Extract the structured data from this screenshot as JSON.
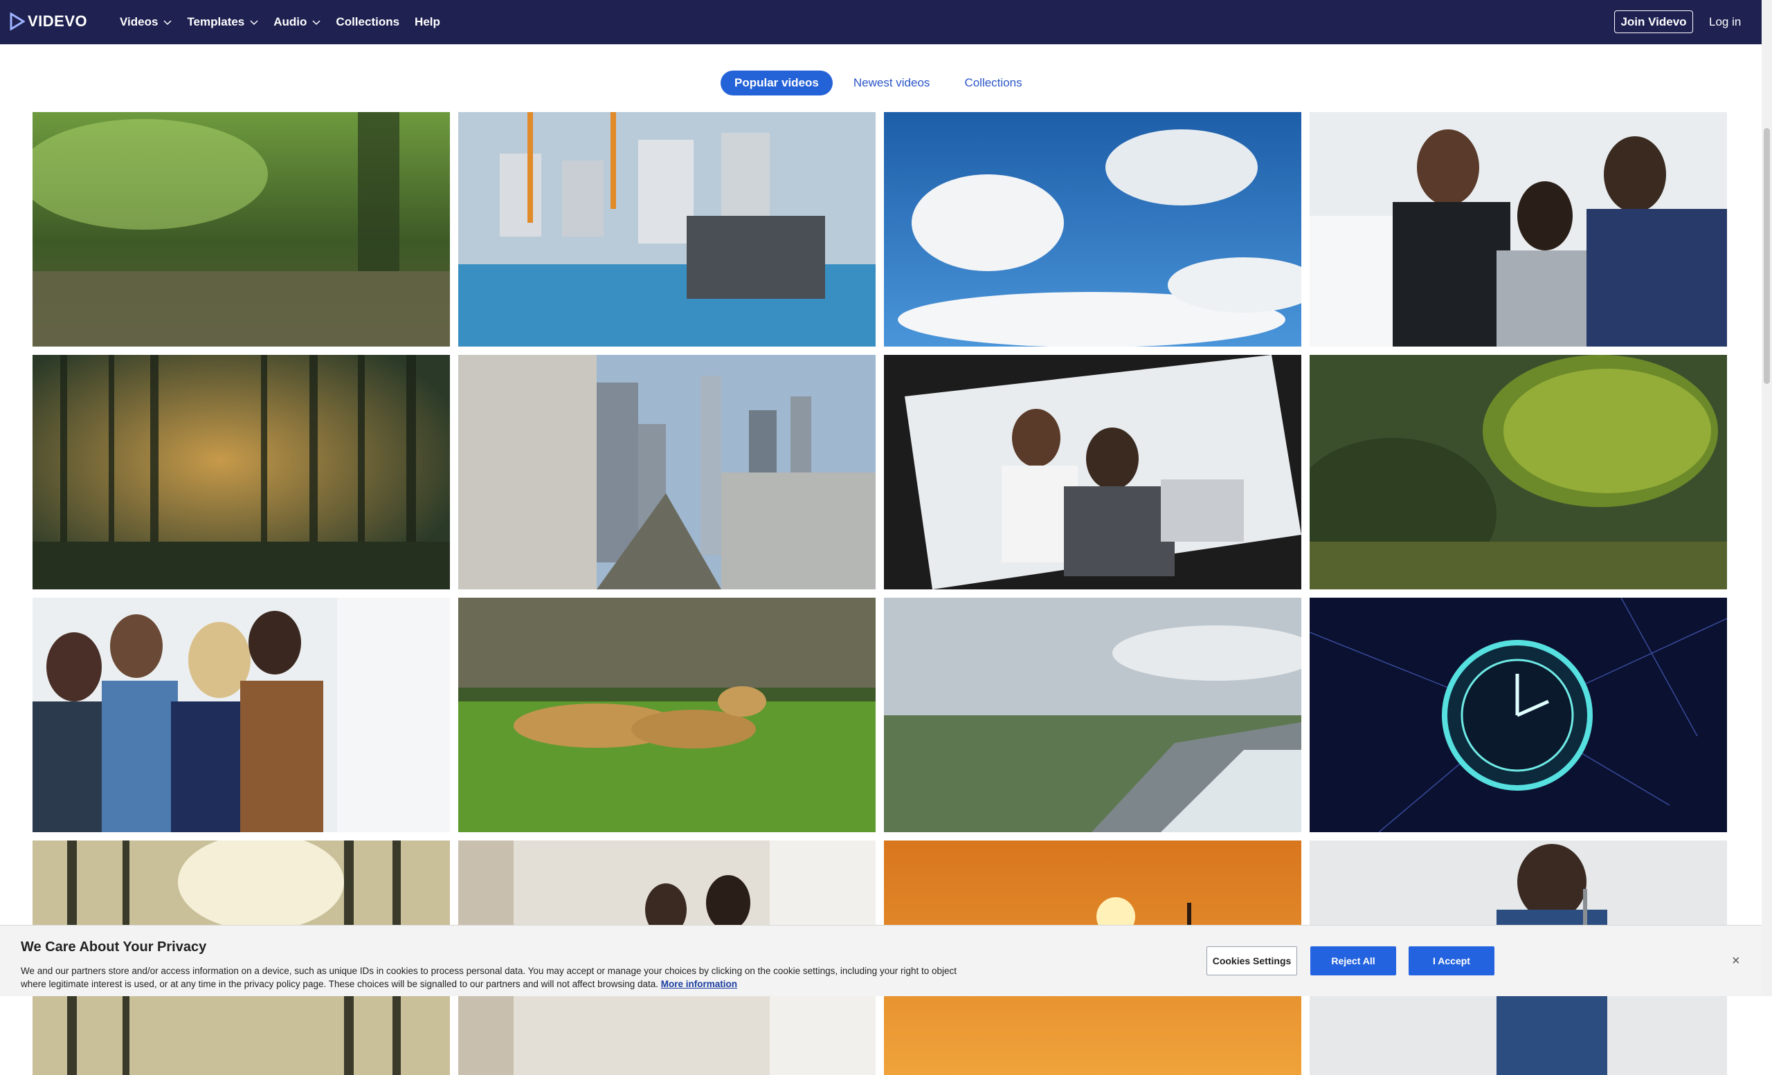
{
  "brand": {
    "name": "VIDEVO",
    "bar_color": "#1f2151",
    "accent": "#2462d8"
  },
  "nav": {
    "items": [
      {
        "label": "Videos",
        "has_dropdown": true
      },
      {
        "label": "Templates",
        "has_dropdown": true
      },
      {
        "label": "Audio",
        "has_dropdown": true
      },
      {
        "label": "Collections",
        "has_dropdown": false
      },
      {
        "label": "Help",
        "has_dropdown": false
      }
    ],
    "join_label": "Join Videvo",
    "login_label": "Log in"
  },
  "tabs": [
    {
      "label": "Popular videos",
      "active": true
    },
    {
      "label": "Newest videos",
      "active": false
    },
    {
      "label": "Collections",
      "active": false
    }
  ],
  "cookie": {
    "title": "We Care About Your Privacy",
    "text": "We and our partners store and/or access information on a device, such as unique IDs in cookies to process personal data. You may accept or manage your choices by clicking on the cookie settings, including your right to object where legitimate interest is used, or at any time in the privacy policy page. These choices will be signalled to our partners and will not affect browsing data.",
    "link_label": "More information",
    "settings_label": "Cookies Settings",
    "reject_label": "Reject All",
    "accept_label": "I Accept",
    "close_label": "×"
  }
}
